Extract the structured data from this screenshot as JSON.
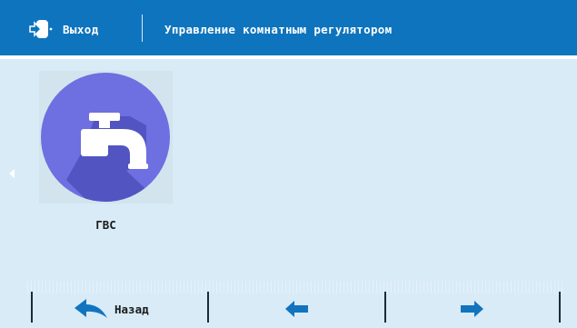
{
  "header": {
    "exit_label": "Выход",
    "title": "Управление комнатным регулятором"
  },
  "tiles": [
    {
      "label": "ГВС",
      "icon": "water-tap-icon"
    }
  ],
  "footer": {
    "back_label": "Назад",
    "prev_icon": "arrow-left-icon",
    "next_icon": "arrow-right-icon"
  },
  "colors": {
    "header": "#0e74bd",
    "background": "#d8ebf7",
    "tile_circle": "#6e6fe0",
    "accent": "#1274be"
  }
}
